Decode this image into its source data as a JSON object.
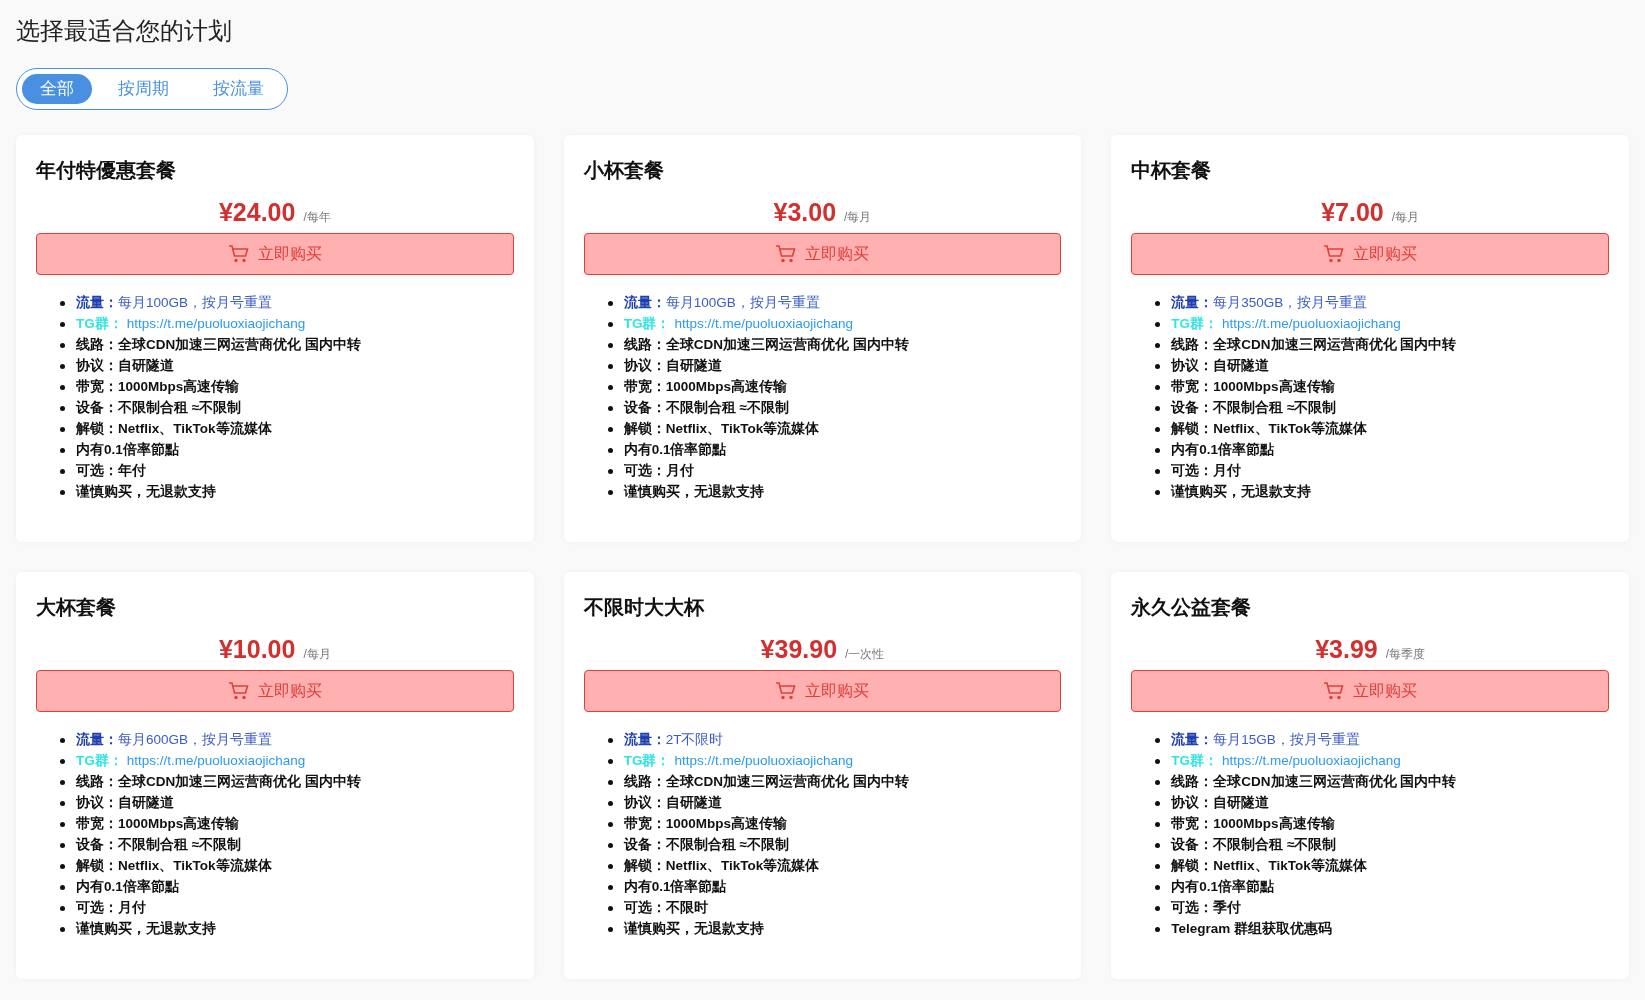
{
  "title": "选择最适合您的计划",
  "filters": [
    {
      "label": "全部",
      "selected": true
    },
    {
      "label": "按周期",
      "selected": false
    },
    {
      "label": "按流量",
      "selected": false
    }
  ],
  "plans": [
    {
      "name": "年付特優惠套餐",
      "price": "¥24.00",
      "period": "/每年",
      "button": "立即购买",
      "features": [
        {
          "kind": "traffic",
          "label": "流量：",
          "value": "每月100GB，按月号重置"
        },
        {
          "kind": "link",
          "label": "TG群：",
          "value": "https://t.me/puoluoxiaojichang"
        },
        {
          "kind": "plain",
          "text": "线路：全球CDN加速三网运营商优化 国内中转"
        },
        {
          "kind": "plain",
          "text": "协议：自研隧道"
        },
        {
          "kind": "plain",
          "text": "带宽：1000Mbps高速传输"
        },
        {
          "kind": "plain",
          "text": "设备：不限制合租 ≈不限制"
        },
        {
          "kind": "plain",
          "text": "解锁：Netflix、TikTok等流媒体"
        },
        {
          "kind": "plain",
          "text": "内有0.1倍率節點"
        },
        {
          "kind": "plain",
          "text": "可选：年付"
        },
        {
          "kind": "plain",
          "text": "谨慎购买，无退款支持"
        }
      ]
    },
    {
      "name": "小杯套餐",
      "price": "¥3.00",
      "period": "/每月",
      "button": "立即购买",
      "features": [
        {
          "kind": "traffic",
          "label": "流量：",
          "value": "每月100GB，按月号重置"
        },
        {
          "kind": "link",
          "label": "TG群：",
          "value": "https://t.me/puoluoxiaojichang"
        },
        {
          "kind": "plain",
          "text": "线路：全球CDN加速三网运营商优化 国内中转"
        },
        {
          "kind": "plain",
          "text": "协议：自研隧道"
        },
        {
          "kind": "plain",
          "text": "带宽：1000Mbps高速传输"
        },
        {
          "kind": "plain",
          "text": "设备：不限制合租 ≈不限制"
        },
        {
          "kind": "plain",
          "text": "解锁：Netflix、TikTok等流媒体"
        },
        {
          "kind": "plain",
          "text": "内有0.1倍率節點"
        },
        {
          "kind": "plain",
          "text": "可选：月付"
        },
        {
          "kind": "plain",
          "text": "谨慎购买，无退款支持"
        }
      ]
    },
    {
      "name": "中杯套餐",
      "price": "¥7.00",
      "period": "/每月",
      "button": "立即购买",
      "features": [
        {
          "kind": "traffic",
          "label": "流量：",
          "value": "每月350GB，按月号重置"
        },
        {
          "kind": "link",
          "label": "TG群：",
          "value": "https://t.me/puoluoxiaojichang"
        },
        {
          "kind": "plain",
          "text": "线路：全球CDN加速三网运营商优化 国内中转"
        },
        {
          "kind": "plain",
          "text": "协议：自研隧道"
        },
        {
          "kind": "plain",
          "text": "带宽：1000Mbps高速传输"
        },
        {
          "kind": "plain",
          "text": "设备：不限制合租 ≈不限制"
        },
        {
          "kind": "plain",
          "text": "解锁：Netflix、TikTok等流媒体"
        },
        {
          "kind": "plain",
          "text": "内有0.1倍率節點"
        },
        {
          "kind": "plain",
          "text": "可选：月付"
        },
        {
          "kind": "plain",
          "text": "谨慎购买，无退款支持"
        }
      ]
    },
    {
      "name": "大杯套餐",
      "price": "¥10.00",
      "period": "/每月",
      "button": "立即购买",
      "features": [
        {
          "kind": "traffic",
          "label": "流量：",
          "value": "每月600GB，按月号重置"
        },
        {
          "kind": "link",
          "label": "TG群：",
          "value": "https://t.me/puoluoxiaojichang"
        },
        {
          "kind": "plain",
          "text": "线路：全球CDN加速三网运营商优化 国内中转"
        },
        {
          "kind": "plain",
          "text": "协议：自研隧道"
        },
        {
          "kind": "plain",
          "text": "带宽：1000Mbps高速传输"
        },
        {
          "kind": "plain",
          "text": "设备：不限制合租 ≈不限制"
        },
        {
          "kind": "plain",
          "text": "解锁：Netflix、TikTok等流媒体"
        },
        {
          "kind": "plain",
          "text": "内有0.1倍率節點"
        },
        {
          "kind": "plain",
          "text": "可选：月付"
        },
        {
          "kind": "plain",
          "text": "谨慎购买，无退款支持"
        }
      ]
    },
    {
      "name": "不限时大大杯",
      "price": "¥39.90",
      "period": "/一次性",
      "button": "立即购买",
      "features": [
        {
          "kind": "traffic",
          "label": "流量：",
          "value": "2T不限时"
        },
        {
          "kind": "link",
          "label": "TG群：",
          "value": "https://t.me/puoluoxiaojichang"
        },
        {
          "kind": "plain",
          "text": "线路：全球CDN加速三网运营商优化 国内中转"
        },
        {
          "kind": "plain",
          "text": "协议：自研隧道"
        },
        {
          "kind": "plain",
          "text": "带宽：1000Mbps高速传输"
        },
        {
          "kind": "plain",
          "text": "设备：不限制合租 ≈不限制"
        },
        {
          "kind": "plain",
          "text": "解锁：Netflix、TikTok等流媒体"
        },
        {
          "kind": "plain",
          "text": "内有0.1倍率節點"
        },
        {
          "kind": "plain",
          "text": "可选：不限时"
        },
        {
          "kind": "plain",
          "text": "谨慎购买，无退款支持"
        }
      ]
    },
    {
      "name": "永久公益套餐",
      "price": "¥3.99",
      "period": "/每季度",
      "button": "立即购买",
      "features": [
        {
          "kind": "traffic",
          "label": "流量：",
          "value": "每月15GB，按月号重置"
        },
        {
          "kind": "link",
          "label": "TG群：",
          "value": "https://t.me/puoluoxiaojichang"
        },
        {
          "kind": "plain",
          "text": "线路：全球CDN加速三网运营商优化 国内中转"
        },
        {
          "kind": "plain",
          "text": "协议：自研隧道"
        },
        {
          "kind": "plain",
          "text": "带宽：1000Mbps高速传输"
        },
        {
          "kind": "plain",
          "text": "设备：不限制合租 ≈不限制"
        },
        {
          "kind": "plain",
          "text": "解锁：Netflix、TikTok等流媒体"
        },
        {
          "kind": "plain",
          "text": "内有0.1倍率節點"
        },
        {
          "kind": "plain",
          "text": "可选：季付"
        },
        {
          "kind": "plain",
          "text": "Telegram 群组获取优惠码"
        }
      ]
    }
  ]
}
